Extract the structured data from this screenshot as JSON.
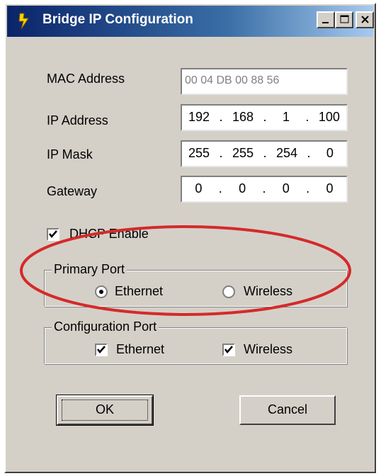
{
  "window": {
    "title": "Bridge IP Configuration"
  },
  "fields": {
    "mac": {
      "label": "MAC Address",
      "value": "00 04 DB 00 88 56"
    },
    "ip": {
      "label": "IP Address",
      "octets": [
        "192",
        "168",
        "1",
        "100"
      ]
    },
    "mask": {
      "label": "IP Mask",
      "octets": [
        "255",
        "255",
        "254",
        "0"
      ]
    },
    "gateway": {
      "label": "Gateway",
      "octets": [
        "0",
        "0",
        "0",
        "0"
      ]
    }
  },
  "dhcp": {
    "label": "DHCP Enable",
    "checked": true
  },
  "primary_port": {
    "title": "Primary Port",
    "ethernet": "Ethernet",
    "wireless": "Wireless",
    "selected": "Ethernet"
  },
  "config_port": {
    "title": "Configuration Port",
    "ethernet": {
      "label": "Ethernet",
      "checked": true
    },
    "wireless": {
      "label": "Wireless",
      "checked": true
    }
  },
  "buttons": {
    "ok": "OK",
    "cancel": "Cancel"
  },
  "colors": {
    "title_bar": "#0a246a",
    "dialog": "#d4d0c8",
    "highlight_ellipse": "#d42a2a"
  }
}
